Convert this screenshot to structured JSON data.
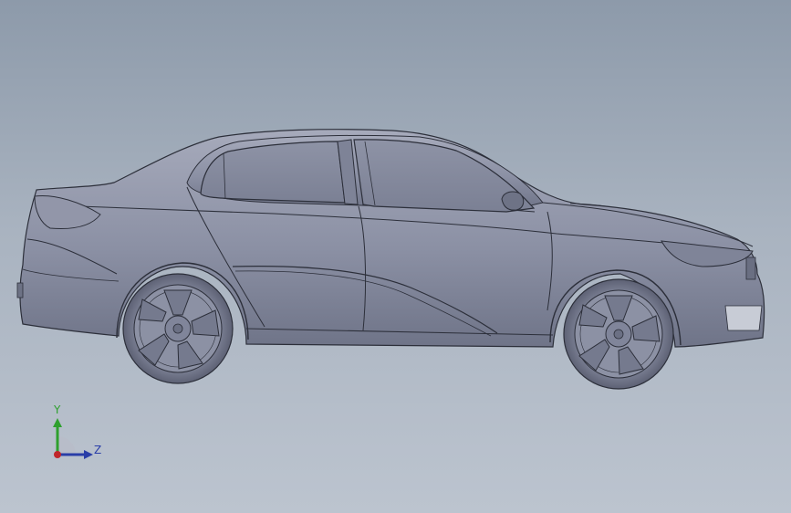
{
  "viewport": {
    "background_top": "#8d9aaa",
    "background_bottom": "#bcc4cf",
    "model_color": "#8a8fa3",
    "edge_color": "#2c2f3a"
  },
  "triad": {
    "y_label": "Y",
    "z_label": "Z",
    "y_color": "#2ea02e",
    "z_color": "#2a3ea8",
    "origin_color": "#c0262a"
  }
}
